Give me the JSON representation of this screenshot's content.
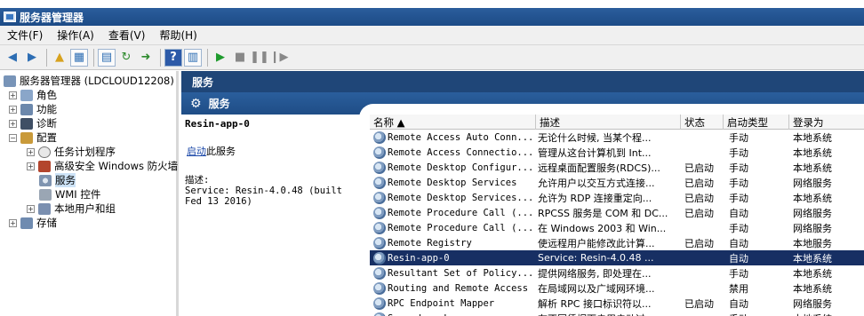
{
  "window": {
    "title": "服务器管理器"
  },
  "menu": [
    {
      "id": "file",
      "label": "文件(F)"
    },
    {
      "id": "action",
      "label": "操作(A)"
    },
    {
      "id": "view",
      "label": "查看(V)"
    },
    {
      "id": "help",
      "label": "帮助(H)"
    }
  ],
  "toolbar": {
    "icons": [
      "back-arrow-icon",
      "forward-arrow-icon",
      "up-folder-icon",
      "show-hide-tree-icon",
      "properties-icon",
      "refresh-icon",
      "export-list-icon",
      "help-icon",
      "console-icon",
      "start-service-icon",
      "stop-service-icon",
      "pause-service-icon",
      "resume-service-icon"
    ]
  },
  "tree": {
    "root": "服务器管理器 (LDCLOUD12208)",
    "items": [
      {
        "label": "角色"
      },
      {
        "label": "功能"
      },
      {
        "label": "诊断"
      },
      {
        "label": "配置"
      },
      {
        "label": "任务计划程序"
      },
      {
        "label": "高级安全 Windows 防火墙"
      },
      {
        "label": "服务"
      },
      {
        "label": "WMI 控件"
      },
      {
        "label": "本地用户和组"
      },
      {
        "label": "存储"
      }
    ]
  },
  "right_header": {
    "title": "服务"
  },
  "services_header": {
    "title": "服务"
  },
  "detail": {
    "name": "Resin-app-0",
    "start_link": "启动",
    "start_suffix": "此服务",
    "desc_label": "描述:",
    "desc_text": "Service: Resin-4.0.48 (built Fed 13 2016)"
  },
  "columns": [
    "名称 ▲",
    "描述",
    "状态",
    "启动类型",
    "登录为"
  ],
  "services": [
    {
      "name": "Remote Access Auto Conn...",
      "desc": "无论什么时候, 当某个程...",
      "status": "",
      "startup": "手动",
      "logon": "本地系统"
    },
    {
      "name": "Remote Access Connectio...",
      "desc": "管理从这台计算机到 Int...",
      "status": "",
      "startup": "手动",
      "logon": "本地系统"
    },
    {
      "name": "Remote Desktop Configur...",
      "desc": "远程桌面配置服务(RDCS)...",
      "status": "已启动",
      "startup": "手动",
      "logon": "本地系统"
    },
    {
      "name": "Remote Desktop Services",
      "desc": "允许用户以交互方式连接...",
      "status": "已启动",
      "startup": "手动",
      "logon": "网络服务"
    },
    {
      "name": "Remote Desktop Services...",
      "desc": "允许为 RDP 连接重定向...",
      "status": "已启动",
      "startup": "手动",
      "logon": "本地系统"
    },
    {
      "name": "Remote Procedure Call (...",
      "desc": "RPCSS 服务是 COM 和 DC...",
      "status": "已启动",
      "startup": "自动",
      "logon": "网络服务"
    },
    {
      "name": "Remote Procedure Call (...",
      "desc": "在 Windows 2003 和 Win...",
      "status": "",
      "startup": "手动",
      "logon": "网络服务"
    },
    {
      "name": "Remote Registry",
      "desc": "使远程用户能修改此计算...",
      "status": "已启动",
      "startup": "自动",
      "logon": "本地服务"
    },
    {
      "name": "Resin-app-0",
      "desc": "Service: Resin-4.0.48 ...",
      "status": "",
      "startup": "自动",
      "logon": "本地系统",
      "selected": true
    },
    {
      "name": "Resultant Set of Policy...",
      "desc": "提供网络服务, 即处理在...",
      "status": "",
      "startup": "手动",
      "logon": "本地系统"
    },
    {
      "name": "Routing and Remote Access",
      "desc": "在局域网以及广域网环境...",
      "status": "",
      "startup": "禁用",
      "logon": "本地系统"
    },
    {
      "name": "RPC Endpoint Mapper",
      "desc": "解析 RPC 接口标识符以...",
      "status": "已启动",
      "startup": "自动",
      "logon": "网络服务"
    },
    {
      "name": "Secondary Logon",
      "desc": "在不同凭据下启用启动过...",
      "status": "",
      "startup": "手动",
      "logon": "本地系统"
    }
  ]
}
